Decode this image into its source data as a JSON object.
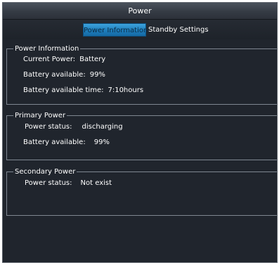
{
  "window": {
    "title": "Power"
  },
  "tabs": [
    {
      "label": "Power Information",
      "active": true
    },
    {
      "label": "Standby Settings",
      "active": false
    }
  ],
  "power_information": {
    "legend": "Power Information",
    "current_power_label": "Current Power:",
    "current_power_value": "Battery",
    "battery_available_label": "Battery available:",
    "battery_available_value": "99%",
    "battery_time_label": "Battery available time:",
    "battery_time_value": "7:10hours"
  },
  "primary_power": {
    "legend": "Primary Power",
    "power_status_label": "Power status:",
    "power_status_value": "discharging",
    "battery_available_label": "Battery available:",
    "battery_available_value": "99%"
  },
  "secondary_power": {
    "legend": "Secondary Power",
    "power_status_label": "Power status:",
    "power_status_value": "Not exist"
  },
  "colors": {
    "background": "#20252d",
    "active_tab": "#1f7fbd",
    "text": "#ffffff",
    "border": "#7f8791"
  }
}
